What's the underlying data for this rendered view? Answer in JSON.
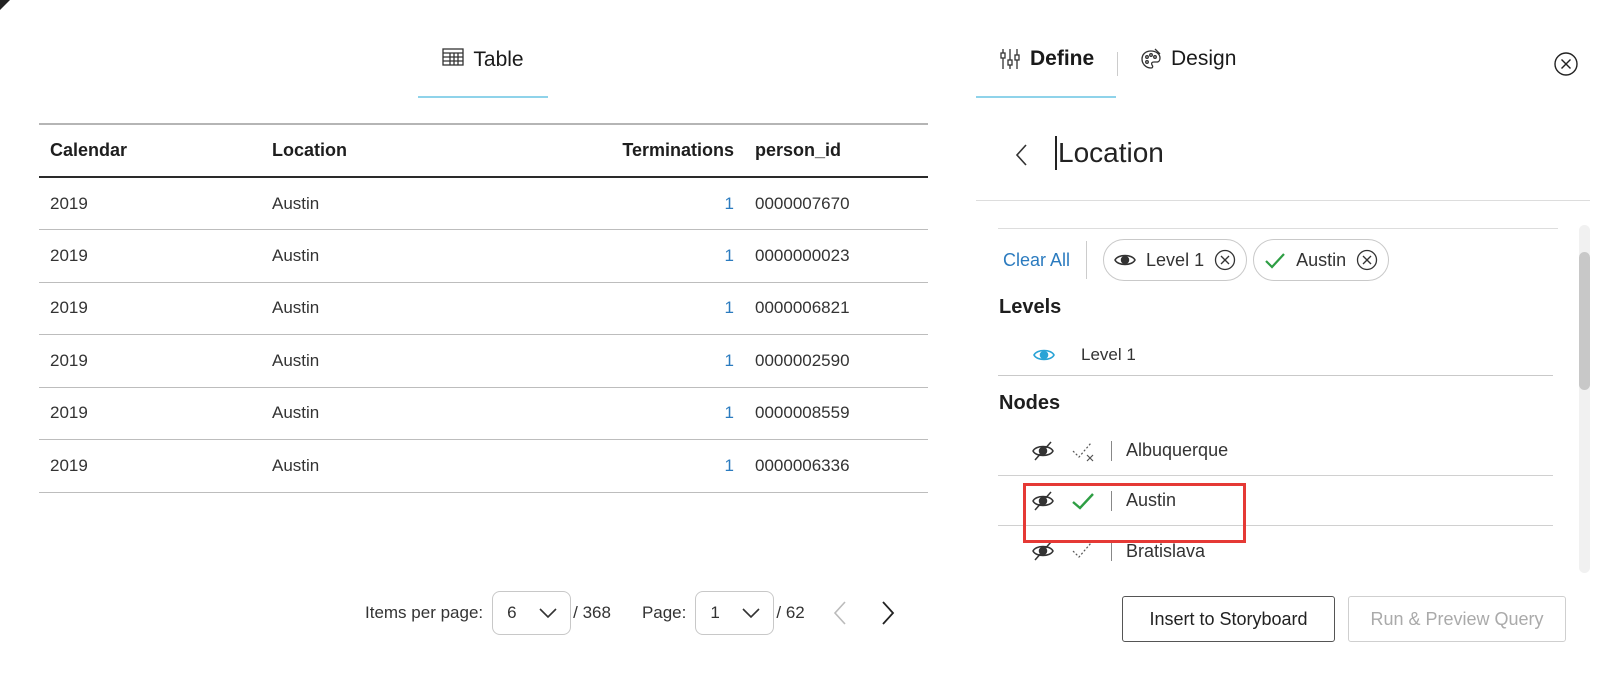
{
  "left_tab": {
    "label": "Table",
    "icon": "table-icon"
  },
  "table": {
    "columns": [
      "Calendar",
      "Location",
      "Terminations",
      "person_id"
    ],
    "rows": [
      [
        "2019",
        "Austin",
        "1",
        "0000007670"
      ],
      [
        "2019",
        "Austin",
        "1",
        "0000000023"
      ],
      [
        "2019",
        "Austin",
        "1",
        "0000006821"
      ],
      [
        "2019",
        "Austin",
        "1",
        "0000002590"
      ],
      [
        "2019",
        "Austin",
        "1",
        "0000008559"
      ],
      [
        "2019",
        "Austin",
        "1",
        "0000006336"
      ]
    ]
  },
  "pager": {
    "items_per_page_label": "Items per page:",
    "items_per_page": "6",
    "total_items": "/ 368",
    "page_label": "Page:",
    "page": "1",
    "total_pages": "/ 62"
  },
  "right_tabs": {
    "define_label": "Define",
    "design_label": "Design",
    "active": "Define"
  },
  "field": {
    "title": "Location"
  },
  "filters": {
    "clear_all": "Clear All",
    "chips": [
      {
        "icon": "eye-icon",
        "label": "Level 1"
      },
      {
        "icon": "check-icon",
        "label": "Austin"
      }
    ]
  },
  "levels": {
    "heading": "Levels",
    "items": [
      {
        "label": "Level 1",
        "visible": true
      }
    ]
  },
  "nodes": {
    "heading": "Nodes",
    "items": [
      {
        "label": "Albuquerque",
        "state": "excluded"
      },
      {
        "label": "Austin",
        "state": "selected"
      },
      {
        "label": "Bratislava",
        "state": "excluded"
      }
    ]
  },
  "buttons": {
    "insert": "Insert to Storyboard",
    "run": "Run & Preview Query"
  },
  "colors": {
    "accent_underline": "#8fd3ea",
    "link_blue": "#2b7bbf",
    "check_green": "#2e9e44",
    "eye_blue": "#29a3d6",
    "highlight_red": "#e53935"
  }
}
